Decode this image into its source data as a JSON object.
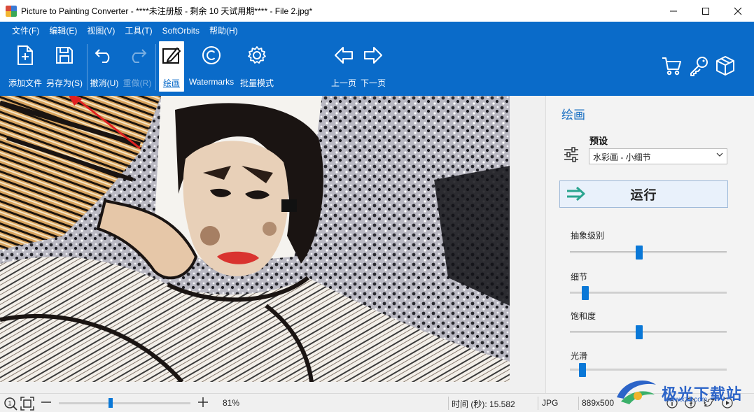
{
  "window": {
    "title": "Picture to Painting Converter - ****未注册版 - 剩余 10 天试用期**** - File 2.jpg*",
    "controls": {
      "minimize": "—",
      "maximize": "☐",
      "close": "✕"
    }
  },
  "menu": [
    "文件(F)",
    "编辑(E)",
    "视图(V)",
    "工具(T)",
    "SoftOrbits",
    "帮助(H)"
  ],
  "toolbar": {
    "add_file": "添加文件",
    "save_as": "另存为(S)",
    "undo": "撤消(U)",
    "redo": "重做(R)",
    "paint": "绘画",
    "watermarks": "Watermarks",
    "batch": "批量模式",
    "prev": "上一页",
    "next": "下一页"
  },
  "panel": {
    "title": "绘画",
    "preset_label": "预设",
    "preset_value": "水彩画 - 小细节",
    "run_label": "运行",
    "params": [
      {
        "label": "抽象级别",
        "value": 0.44
      },
      {
        "label": "细节",
        "value": 0.08
      },
      {
        "label": "饱和度",
        "value": 0.44
      },
      {
        "label": "光滑",
        "value": 0.06
      }
    ]
  },
  "status": {
    "zoom": "81%",
    "zoom_fraction": 0.39,
    "time": "时间 (秒): 15.582",
    "format": "JPG",
    "dimensions": "889x500"
  },
  "watermark": {
    "text": "极光下载站",
    "url": "www.xz7.com"
  },
  "colors": {
    "accent": "#0a6bc9",
    "slider": "#0a78d7",
    "panel_title": "#1a6fc2"
  }
}
